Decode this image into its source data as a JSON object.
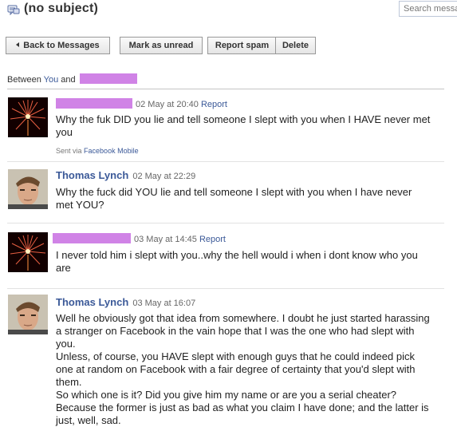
{
  "header": {
    "title": "(no subject)",
    "search_placeholder": "Search messages"
  },
  "toolbar": {
    "back": "Back to Messages",
    "mark_unread": "Mark as unread",
    "report_spam": "Report spam",
    "delete": "Delete"
  },
  "between": {
    "prefix": "Between",
    "you": "You",
    "and": "and"
  },
  "messages": [
    {
      "sender": "",
      "time": "02 May at 20:40",
      "report": "Report",
      "body": "Why the fuk DID you lie and tell someone I slept with you when I HAVE never met you",
      "sent_prefix": "Sent via",
      "sent_via": "Facebook Mobile"
    },
    {
      "sender": "Thomas Lynch",
      "time": "02 May at 22:29",
      "body": "Why the fuck did YOU lie and tell someone I slept with you when I have never met YOU?"
    },
    {
      "sender": "",
      "time": "03 May at 14:45",
      "report": "Report",
      "body": "I never told him i slept with you..why the hell would i when i dont know who you are"
    },
    {
      "sender": "Thomas Lynch",
      "time": "03 May at 16:07",
      "body_lines": [
        "Well he obviously got that idea from somewhere. I doubt he just started harassing a stranger on Facebook in the vain hope that I was the one who had slept with you.",
        "Unless, of course, you HAVE slept with enough guys that he could indeed pick one at random on Facebook with a fair degree of certainty that you'd slept with them.",
        "So which one is it? Did you give him my name or are you a serial cheater? Because the former is just as bad as what you claim I have done; and the latter is just, well, sad."
      ]
    }
  ]
}
